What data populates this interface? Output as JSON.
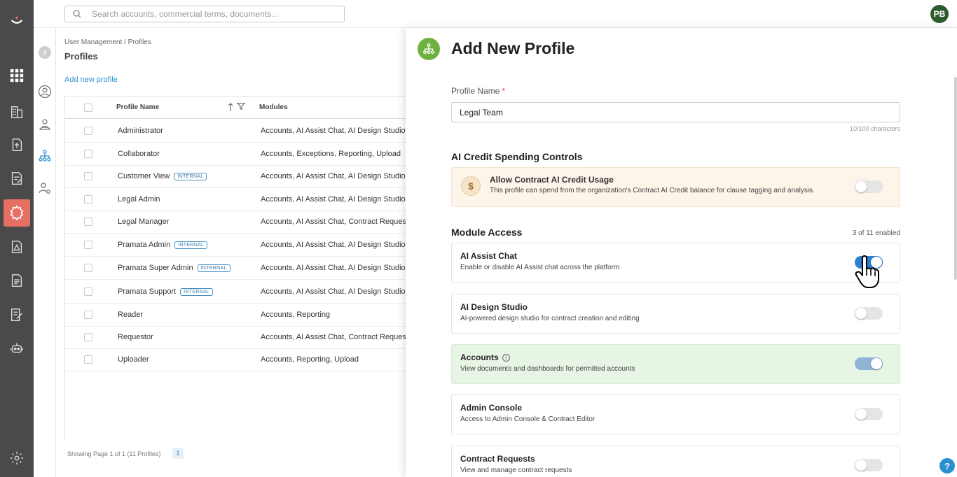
{
  "search": {
    "placeholder": "Search accounts, commercial terms, documents..."
  },
  "user": {
    "initials": "PB"
  },
  "breadcrumb": "User Management / Profiles",
  "page_title": "Profiles",
  "add_link": "Add new profile",
  "table": {
    "headers": {
      "name": "Profile Name",
      "modules": "Modules"
    },
    "rows": [
      {
        "name": "Administrator",
        "badge": "",
        "modules": "Accounts, AI Assist Chat, AI Design Studio,"
      },
      {
        "name": "Collaborator",
        "badge": "",
        "modules": "Accounts, Exceptions, Reporting, Upload"
      },
      {
        "name": "Customer View",
        "badge": "INTERNAL",
        "modules": "Accounts, AI Assist Chat, AI Design Studio,"
      },
      {
        "name": "Legal Admin",
        "badge": "",
        "modules": "Accounts, AI Assist Chat, AI Design Studio,"
      },
      {
        "name": "Legal Manager",
        "badge": "",
        "modules": "Accounts, AI Assist Chat, Contract Request"
      },
      {
        "name": "Pramata Admin",
        "badge": "INTERNAL",
        "modules": "Accounts, AI Assist Chat, AI Design Studio,"
      },
      {
        "name": "Pramata Super Admin",
        "badge": "INTERNAL",
        "modules": "Accounts, AI Assist Chat, AI Design Studio,"
      },
      {
        "name": "Pramata Support",
        "badge": "INTERNAL",
        "modules": "Accounts, AI Assist Chat, AI Design Studio,"
      },
      {
        "name": "Reader",
        "badge": "",
        "modules": "Accounts, Reporting"
      },
      {
        "name": "Requestor",
        "badge": "",
        "modules": "Accounts, AI Assist Chat, Contract Request"
      },
      {
        "name": "Uploader",
        "badge": "",
        "modules": "Accounts, Reporting, Upload"
      }
    ],
    "footer": "Showing Page 1 of 1 (11 Profiles)",
    "page": "1"
  },
  "panel": {
    "title": "Add New Profile",
    "profile_name_label": "Profile Name",
    "required_mark": "*",
    "profile_name_value": "Legal Team",
    "char_count": "10/100 characters",
    "credit_section_title": "AI Credit Spending Controls",
    "credit_icon": "$",
    "credit_title": "Allow Contract AI Credit Usage",
    "credit_desc": "This profile can spend from the organization's Contract AI Credit balance for clause tagging and analysis.",
    "credit_enabled": false,
    "module_section_title": "Module Access",
    "enabled_count": "3 of 11 enabled",
    "modules": [
      {
        "title": "AI Assist Chat",
        "desc": "Enable or disable AI Assist chat across the platform",
        "enabled": true
      },
      {
        "title": "AI Design Studio",
        "desc": "AI-powered design studio for contract creation and editing",
        "enabled": false
      },
      {
        "title": "Accounts",
        "desc": "View documents and dashboards for permitted accounts",
        "enabled": true
      },
      {
        "title": "Admin Console",
        "desc": "Access to Admin Console & Contract Editor",
        "enabled": false
      },
      {
        "title": "Contract Requests",
        "desc": "View and manage contract requests",
        "enabled": false
      }
    ]
  },
  "help_label": "?",
  "colors": {
    "accent": "#2e7fd3",
    "brand_active": "#e66f63",
    "panel_icon": "#6cb23c",
    "avatar": "#2e5a2f"
  }
}
